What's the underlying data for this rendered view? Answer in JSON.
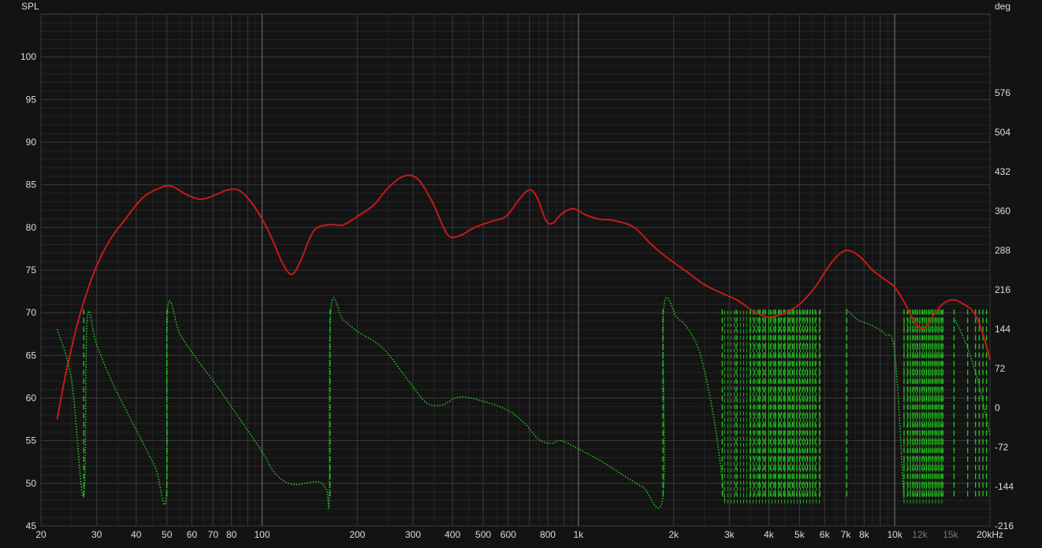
{
  "chart_data": {
    "type": "line",
    "x_scale": "log",
    "xlim": [
      20,
      20000
    ],
    "ylim": [
      45,
      105
    ],
    "y2lim": [
      -216,
      720
    ],
    "grid": true,
    "left_axis_label": "SPL",
    "right_axis_label": "deg",
    "x_ticks": [
      {
        "v": 20,
        "label": "20"
      },
      {
        "v": 30,
        "label": "30"
      },
      {
        "v": 40,
        "label": "40"
      },
      {
        "v": 50,
        "label": "50"
      },
      {
        "v": 60,
        "label": "60"
      },
      {
        "v": 70,
        "label": "70"
      },
      {
        "v": 80,
        "label": "80"
      },
      {
        "v": 100,
        "label": "100"
      },
      {
        "v": 200,
        "label": "200"
      },
      {
        "v": 300,
        "label": "300"
      },
      {
        "v": 400,
        "label": "400"
      },
      {
        "v": 500,
        "label": "500"
      },
      {
        "v": 600,
        "label": "600"
      },
      {
        "v": 800,
        "label": "800"
      },
      {
        "v": 1000,
        "label": "1k"
      },
      {
        "v": 2000,
        "label": "2k"
      },
      {
        "v": 3000,
        "label": "3k"
      },
      {
        "v": 4000,
        "label": "4k"
      },
      {
        "v": 5000,
        "label": "5k"
      },
      {
        "v": 6000,
        "label": "6k"
      },
      {
        "v": 7000,
        "label": "7k"
      },
      {
        "v": 8000,
        "label": "8k"
      },
      {
        "v": 10000,
        "label": "10k"
      },
      {
        "v": 12000,
        "label": "12k",
        "dim": true
      },
      {
        "v": 15000,
        "label": "15k",
        "dim": true
      },
      {
        "v": 20000,
        "label": "20kHz"
      }
    ],
    "y_ticks": [
      45,
      50,
      55,
      60,
      65,
      70,
      75,
      80,
      85,
      90,
      95,
      100
    ],
    "y2_ticks": [
      -216,
      -144,
      -72,
      0,
      72,
      144,
      216,
      288,
      360,
      432,
      504,
      576
    ],
    "colors": {
      "background": "#131313",
      "spl": "#c41a1a",
      "phase": "#22c81e",
      "grid_minor": "#3a3a3a",
      "grid_major": "#5a5a5a",
      "label": "#dcdcdc",
      "label_dim": "#7a7a7a"
    },
    "series": [
      {
        "style": "solid",
        "color": "#c41a1a",
        "axis": "left",
        "points": [
          [
            22.5,
            57.5
          ],
          [
            24,
            63
          ],
          [
            26,
            68.5
          ],
          [
            28,
            72.5
          ],
          [
            30,
            75.5
          ],
          [
            33,
            78.5
          ],
          [
            37,
            81
          ],
          [
            42,
            83.5
          ],
          [
            48,
            84.7
          ],
          [
            52,
            84.8
          ],
          [
            58,
            83.8
          ],
          [
            64,
            83.3
          ],
          [
            70,
            83.7
          ],
          [
            78,
            84.4
          ],
          [
            85,
            84.3
          ],
          [
            93,
            82.8
          ],
          [
            100,
            81
          ],
          [
            108,
            78.5
          ],
          [
            116,
            75.8
          ],
          [
            124,
            74.5
          ],
          [
            132,
            76
          ],
          [
            145,
            79.5
          ],
          [
            160,
            80.3
          ],
          [
            180,
            80.3
          ],
          [
            200,
            81.3
          ],
          [
            225,
            82.6
          ],
          [
            250,
            84.6
          ],
          [
            280,
            86
          ],
          [
            310,
            85.7
          ],
          [
            345,
            83
          ],
          [
            385,
            79.2
          ],
          [
            420,
            79
          ],
          [
            470,
            80
          ],
          [
            530,
            80.7
          ],
          [
            590,
            81.3
          ],
          [
            650,
            83.3
          ],
          [
            700,
            84.4
          ],
          [
            740,
            83.5
          ],
          [
            790,
            80.8
          ],
          [
            830,
            80.5
          ],
          [
            880,
            81.5
          ],
          [
            960,
            82.2
          ],
          [
            1050,
            81.5
          ],
          [
            1150,
            81
          ],
          [
            1300,
            80.8
          ],
          [
            1500,
            80
          ],
          [
            1700,
            78
          ],
          [
            1900,
            76.5
          ],
          [
            2200,
            74.8
          ],
          [
            2500,
            73.3
          ],
          [
            2800,
            72.4
          ],
          [
            3200,
            71.4
          ],
          [
            3600,
            70.1
          ],
          [
            4000,
            69.5
          ],
          [
            4500,
            70
          ],
          [
            5000,
            71
          ],
          [
            5600,
            73
          ],
          [
            6200,
            75.5
          ],
          [
            6800,
            77.1
          ],
          [
            7300,
            77.2
          ],
          [
            7900,
            76.3
          ],
          [
            8500,
            75
          ],
          [
            9300,
            73.9
          ],
          [
            10000,
            73
          ],
          [
            10800,
            71
          ],
          [
            11600,
            68.8
          ],
          [
            12400,
            68.2
          ],
          [
            13400,
            70
          ],
          [
            14400,
            71.2
          ],
          [
            15400,
            71.5
          ],
          [
            16500,
            71
          ],
          [
            17800,
            70
          ],
          [
            19000,
            67.5
          ],
          [
            20000,
            64.5
          ]
        ]
      },
      {
        "style": "dotted",
        "color": "#22c81e",
        "axis": "right",
        "points": [
          [
            22.5,
            144
          ],
          [
            25,
            50
          ],
          [
            27.3,
            -162
          ],
          [
            28,
            162
          ],
          [
            30,
            115
          ],
          [
            34,
            40
          ],
          [
            40,
            -40
          ],
          [
            46,
            -110
          ],
          [
            49.8,
            -162
          ],
          [
            50.3,
            180
          ],
          [
            55,
            135
          ],
          [
            62,
            90
          ],
          [
            72,
            40
          ],
          [
            85,
            -20
          ],
          [
            100,
            -80
          ],
          [
            110,
            -120
          ],
          [
            125,
            -140
          ],
          [
            150,
            -135
          ],
          [
            160,
            -150
          ],
          [
            163,
            -162
          ],
          [
            165,
            180
          ],
          [
            180,
            162
          ],
          [
            200,
            140
          ],
          [
            240,
            110
          ],
          [
            290,
            50
          ],
          [
            330,
            10
          ],
          [
            370,
            5
          ],
          [
            420,
            20
          ],
          [
            500,
            12
          ],
          [
            600,
            -5
          ],
          [
            680,
            -30
          ],
          [
            750,
            -58
          ],
          [
            820,
            -65
          ],
          [
            880,
            -60
          ],
          [
            1000,
            -75
          ],
          [
            1200,
            -100
          ],
          [
            1400,
            -125
          ],
          [
            1600,
            -145
          ],
          [
            1850,
            -162
          ],
          [
            1860,
            180
          ],
          [
            2050,
            165
          ],
          [
            2250,
            140
          ],
          [
            2450,
            90
          ],
          [
            2700,
            -30
          ],
          [
            2900,
            -170
          ]
        ]
      },
      {
        "style": "dotted",
        "color": "#22c81e",
        "axis": "right",
        "points": [
          [
            7050,
            180
          ],
          [
            7600,
            162
          ],
          [
            8500,
            150
          ],
          [
            9300,
            135
          ],
          [
            10000,
            100
          ],
          [
            10700,
            -170
          ]
        ]
      },
      {
        "style": "dotted",
        "color": "#22c81e",
        "axis": "right",
        "points": [
          [
            15400,
            165
          ],
          [
            17000,
            110
          ],
          [
            18500,
            40
          ],
          [
            20000,
            -50
          ]
        ]
      }
    ],
    "wrap_bands": [
      {
        "x_start": 2900,
        "x_end": 5800,
        "phase_low": -175,
        "phase_high": 180
      },
      {
        "x_start": 10700,
        "x_end": 14200,
        "phase_low": -175,
        "phase_high": 180
      }
    ],
    "wrap_lines": [
      27.3,
      50,
      164,
      1850,
      2850,
      3150,
      3500,
      3600,
      3700,
      3750,
      3850,
      3900,
      4000,
      4050,
      4150,
      4200,
      4300,
      4350,
      4450,
      4500,
      4600,
      4650,
      4750,
      4800,
      4900,
      5000,
      5100,
      5200,
      5300,
      5400,
      5500,
      5600,
      5800,
      7050,
      10700,
      11000,
      11200,
      11400,
      11600,
      11800,
      12000,
      12200,
      12400,
      12600,
      12800,
      13000,
      13200,
      13400,
      13600,
      13800,
      14000,
      14200,
      15400,
      17000,
      18000,
      18500,
      19000,
      19500
    ]
  }
}
